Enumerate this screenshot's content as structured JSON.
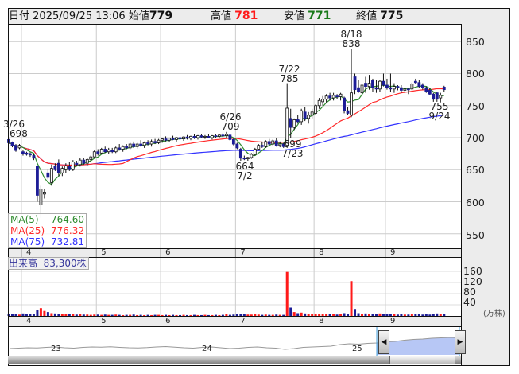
{
  "header": {
    "date_label": "日付",
    "date_value": "2025/09/25 13:06",
    "open_label": "始値",
    "open_value": "779",
    "high_label": "高値",
    "high_value": "781",
    "low_label": "安値",
    "low_value": "771",
    "close_label": "終値",
    "close_value": "775"
  },
  "colors": {
    "up_body": "#ffffff",
    "down_body": "#1c1c96",
    "ma5": "#2e8b2e",
    "ma25": "#ff2a2a",
    "ma75": "#3333ff",
    "vol_up": "#ff1a1a",
    "vol_down": "#1c1c96",
    "high": "#ff1a1a",
    "low": "#1a7a1a"
  },
  "legend": [
    {
      "label": "MA(5)",
      "value": "764.60"
    },
    {
      "label": "MA(25)",
      "value": "776.32"
    },
    {
      "label": "MA(75)",
      "value": "732.81"
    }
  ],
  "volume_label": {
    "label": "出来高",
    "value": "83,300株"
  },
  "annotations": [
    {
      "date": "3/26",
      "value": "698"
    },
    {
      "date": "6/26",
      "value": "709"
    },
    {
      "date": "7/2",
      "value": "664"
    },
    {
      "date": "7/22",
      "value": "785"
    },
    {
      "date": "7/23",
      "value": "699"
    },
    {
      "date": "8/18",
      "value": "838"
    },
    {
      "date": "9/24",
      "value": "755"
    }
  ],
  "chart_data": {
    "type": "candlestick",
    "price_axis": {
      "ticks": [
        "850",
        "800",
        "750",
        "700",
        "650",
        "600",
        "550"
      ],
      "tick_values": [
        850,
        800,
        750,
        700,
        650,
        600,
        550
      ],
      "range": [
        528,
        878
      ]
    },
    "volume_axis": {
      "ticks": [
        "160",
        "120",
        "80",
        "40"
      ],
      "tick_values": [
        160,
        120,
        80,
        40
      ],
      "unit": "(万株)"
    },
    "month_ticks": [
      {
        "label": "4",
        "index": 4
      },
      {
        "label": "5",
        "index": 25
      },
      {
        "label": "6",
        "index": 43
      },
      {
        "label": "7",
        "index": 64
      },
      {
        "label": "8",
        "index": 86
      },
      {
        "label": "9",
        "index": 106
      }
    ],
    "ohlc": [
      [
        697,
        698,
        690,
        692
      ],
      [
        692,
        694,
        685,
        688
      ],
      [
        688,
        690,
        678,
        680
      ],
      [
        684,
        690,
        682,
        688
      ],
      [
        678,
        680,
        672,
        675
      ],
      [
        676,
        678,
        672,
        674
      ],
      [
        675,
        677,
        670,
        673
      ],
      [
        672,
        674,
        665,
        668
      ],
      [
        655,
        656,
        600,
        610
      ],
      [
        595,
        625,
        575,
        620
      ],
      [
        612,
        620,
        605,
        615
      ],
      [
        645,
        650,
        635,
        638
      ],
      [
        630,
        658,
        625,
        652
      ],
      [
        655,
        660,
        648,
        650
      ],
      [
        660,
        666,
        640,
        645
      ],
      [
        645,
        655,
        640,
        652
      ],
      [
        650,
        660,
        645,
        656
      ],
      [
        655,
        662,
        648,
        650
      ],
      [
        650,
        665,
        648,
        662
      ],
      [
        660,
        664,
        655,
        658
      ],
      [
        658,
        668,
        655,
        665
      ],
      [
        665,
        668,
        658,
        660
      ],
      [
        660,
        668,
        656,
        666
      ],
      [
        666,
        672,
        662,
        670
      ],
      [
        670,
        680,
        668,
        678
      ],
      [
        678,
        682,
        672,
        675
      ],
      [
        676,
        684,
        674,
        682
      ],
      [
        682,
        686,
        676,
        678
      ],
      [
        678,
        684,
        675,
        681
      ],
      [
        680,
        684,
        676,
        678
      ],
      [
        678,
        686,
        676,
        684
      ],
      [
        684,
        690,
        680,
        682
      ],
      [
        682,
        688,
        678,
        686
      ],
      [
        686,
        690,
        682,
        684
      ],
      [
        684,
        692,
        682,
        690
      ],
      [
        690,
        694,
        684,
        686
      ],
      [
        686,
        692,
        683,
        690
      ],
      [
        690,
        696,
        686,
        688
      ],
      [
        688,
        694,
        684,
        692
      ],
      [
        692,
        696,
        688,
        690
      ],
      [
        690,
        697,
        686,
        694
      ],
      [
        694,
        698,
        690,
        692
      ],
      [
        692,
        698,
        690,
        696
      ],
      [
        696,
        700,
        692,
        698
      ],
      [
        698,
        702,
        694,
        696
      ],
      [
        696,
        700,
        693,
        699
      ],
      [
        699,
        703,
        696,
        697
      ],
      [
        697,
        701,
        694,
        700
      ],
      [
        700,
        703,
        696,
        698
      ],
      [
        698,
        702,
        695,
        701
      ],
      [
        701,
        704,
        697,
        699
      ],
      [
        699,
        703,
        696,
        702
      ],
      [
        702,
        705,
        698,
        700
      ],
      [
        700,
        704,
        697,
        703
      ],
      [
        703,
        705,
        699,
        701
      ],
      [
        701,
        704,
        698,
        702
      ],
      [
        702,
        705,
        699,
        700
      ],
      [
        700,
        704,
        697,
        703
      ],
      [
        703,
        706,
        700,
        702
      ],
      [
        702,
        705,
        699,
        704
      ],
      [
        704,
        707,
        701,
        703
      ],
      [
        703,
        709,
        700,
        705
      ],
      [
        704,
        706,
        695,
        697
      ],
      [
        697,
        699,
        688,
        690
      ],
      [
        690,
        692,
        682,
        684
      ],
      [
        682,
        684,
        664,
        668
      ],
      [
        668,
        672,
        665,
        667
      ],
      [
        667,
        670,
        664,
        669
      ],
      [
        669,
        676,
        667,
        674
      ],
      [
        674,
        684,
        672,
        682
      ],
      [
        682,
        690,
        680,
        688
      ],
      [
        688,
        694,
        684,
        686
      ],
      [
        686,
        696,
        684,
        694
      ],
      [
        694,
        698,
        688,
        690
      ],
      [
        690,
        697,
        688,
        695
      ],
      [
        695,
        699,
        686,
        688
      ],
      [
        688,
        694,
        685,
        690
      ],
      [
        690,
        692,
        684,
        686
      ],
      [
        688,
        785,
        684,
        746
      ],
      [
        730,
        745,
        699,
        716
      ],
      [
        716,
        730,
        712,
        728
      ],
      [
        728,
        735,
        722,
        725
      ],
      [
        725,
        745,
        720,
        742
      ],
      [
        740,
        748,
        726,
        730
      ],
      [
        730,
        740,
        722,
        735
      ],
      [
        735,
        745,
        730,
        740
      ],
      [
        738,
        752,
        735,
        750
      ],
      [
        750,
        762,
        745,
        758
      ],
      [
        756,
        765,
        750,
        760
      ],
      [
        760,
        768,
        755,
        765
      ],
      [
        765,
        770,
        758,
        762
      ],
      [
        762,
        770,
        758,
        766
      ],
      [
        765,
        768,
        760,
        764
      ],
      [
        764,
        770,
        758,
        768
      ],
      [
        762,
        764,
        738,
        742
      ],
      [
        742,
        748,
        735,
        738
      ],
      [
        735,
        838,
        732,
        770
      ],
      [
        795,
        800,
        768,
        775
      ],
      [
        778,
        790,
        770,
        772
      ],
      [
        770,
        785,
        765,
        782
      ],
      [
        785,
        795,
        770,
        780
      ],
      [
        780,
        798,
        775,
        785
      ],
      [
        790,
        792,
        772,
        778
      ],
      [
        778,
        790,
        770,
        776
      ],
      [
        776,
        790,
        772,
        788
      ],
      [
        788,
        800,
        780,
        782
      ],
      [
        782,
        792,
        775,
        778
      ],
      [
        778,
        800,
        772,
        776
      ],
      [
        776,
        785,
        770,
        780
      ],
      [
        780,
        782,
        774,
        778
      ],
      [
        778,
        782,
        770,
        774
      ],
      [
        774,
        778,
        770,
        776
      ],
      [
        776,
        778,
        768,
        775
      ],
      [
        776,
        786,
        774,
        784
      ],
      [
        788,
        792,
        784,
        786
      ],
      [
        786,
        790,
        778,
        780
      ],
      [
        782,
        785,
        775,
        778
      ],
      [
        778,
        780,
        770,
        772
      ],
      [
        774,
        778,
        766,
        768
      ],
      [
        768,
        770,
        756,
        760
      ],
      [
        770,
        772,
        756,
        760
      ],
      [
        762,
        770,
        755,
        766
      ],
      [
        779,
        781,
        771,
        775
      ]
    ],
    "volume": [
      8,
      6,
      7,
      5,
      9,
      8,
      7,
      8,
      22,
      28,
      18,
      14,
      10,
      9,
      8,
      7,
      6,
      7,
      6,
      5,
      6,
      5,
      5,
      4,
      5,
      5,
      4,
      5,
      4,
      4,
      5,
      4,
      3,
      4,
      4,
      5,
      3,
      4,
      3,
      4,
      3,
      4,
      4,
      3,
      4,
      3,
      4,
      3,
      3,
      4,
      3,
      3,
      4,
      3,
      3,
      4,
      3,
      3,
      4,
      3,
      4,
      6,
      4,
      5,
      7,
      8,
      6,
      5,
      5,
      6,
      5,
      4,
      5,
      4,
      4,
      5,
      4,
      4,
      158,
      30,
      14,
      10,
      12,
      9,
      8,
      7,
      8,
      7,
      6,
      7,
      6,
      6,
      5,
      6,
      10,
      7,
      125,
      25,
      10,
      8,
      9,
      8,
      8,
      7,
      9,
      8,
      7,
      6,
      6,
      5,
      6,
      5,
      5,
      6,
      7,
      6,
      5,
      6,
      5,
      6,
      9,
      7,
      6
    ],
    "ma_periods": [
      5,
      25,
      75
    ]
  },
  "navigator": {
    "year_labels": [
      "23",
      "24",
      "25"
    ],
    "values": [
      640,
      645,
      650,
      648,
      655,
      660,
      650,
      645,
      655,
      660,
      658,
      662,
      655,
      650,
      648,
      652,
      660,
      665,
      658,
      650,
      645,
      655,
      660,
      650,
      640,
      645,
      655,
      660,
      650,
      645,
      630,
      640,
      655,
      660,
      665,
      670,
      690,
      700,
      695,
      705,
      710,
      725,
      730,
      745,
      755,
      760,
      770,
      775,
      780,
      775
    ],
    "selected_from": 0.83
  }
}
